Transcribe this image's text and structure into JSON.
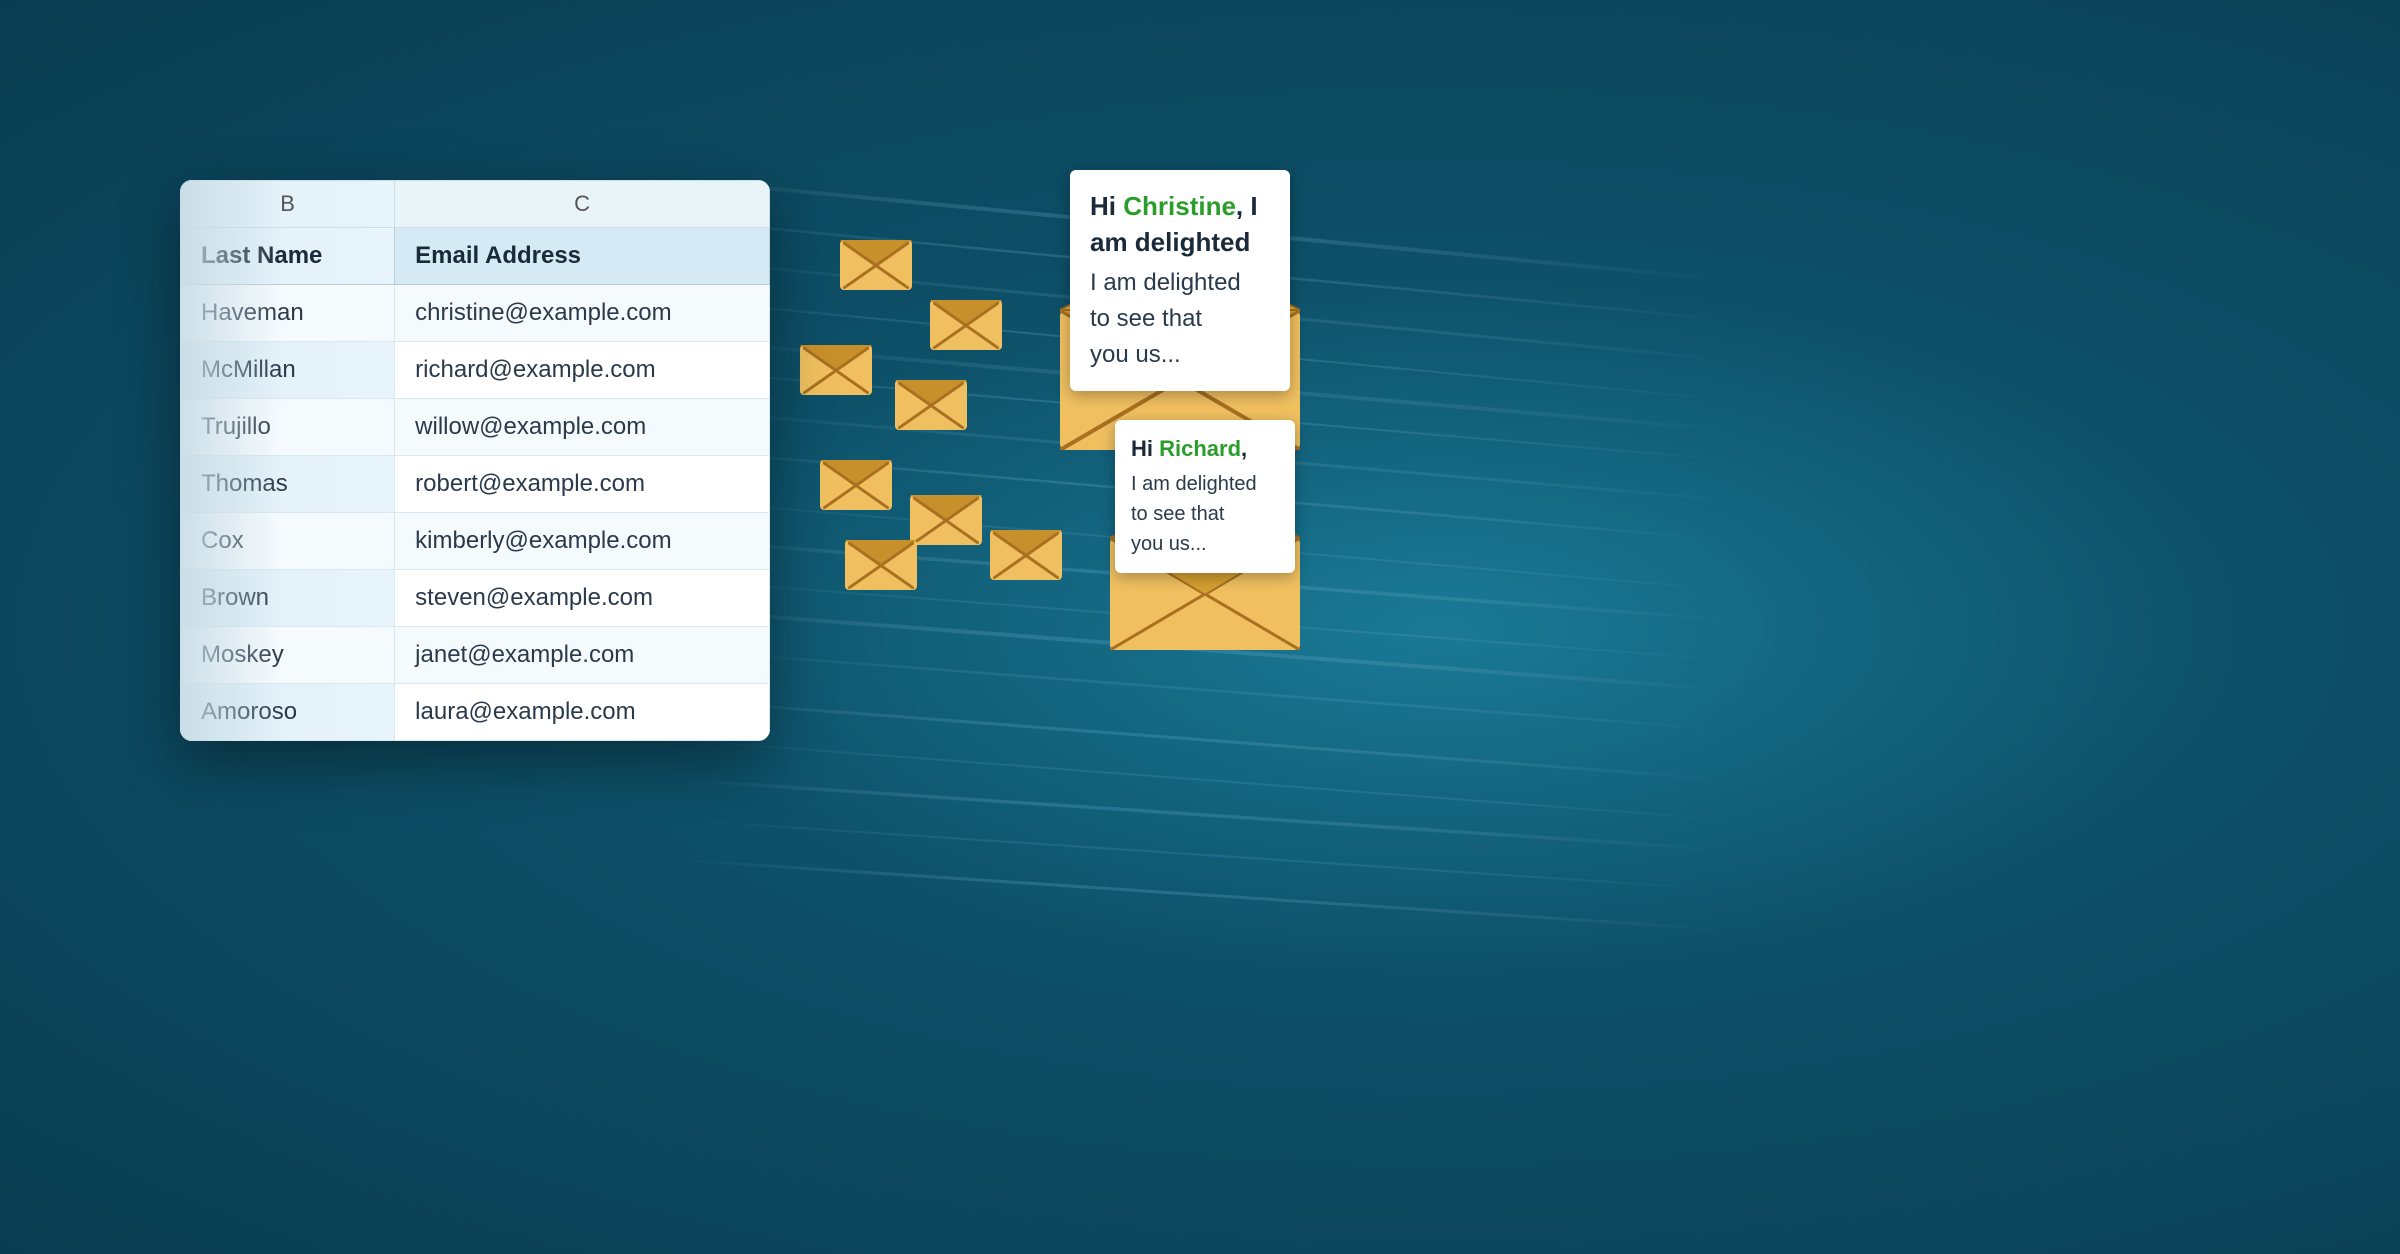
{
  "background": {
    "color": "#0d5068"
  },
  "spreadsheet": {
    "col_b_label": "B",
    "col_c_label": "C",
    "header_last_name": "Last Name",
    "header_email": "Email Address",
    "rows": [
      {
        "last_name": "Haveman",
        "email": "christine@example.com"
      },
      {
        "last_name": "McMillan",
        "email": "richard@example.com"
      },
      {
        "last_name": "Trujillo",
        "email": "willow@example.com"
      },
      {
        "last_name": "Thomas",
        "email": "robert@example.com"
      },
      {
        "last_name": "Cox",
        "email": "kimberly@example.com"
      },
      {
        "last_name": "Brown",
        "email": "steven@example.com"
      },
      {
        "last_name": "Moskey",
        "email": "janet@example.com"
      },
      {
        "last_name": "Amoroso",
        "email": "laura@example.com"
      }
    ]
  },
  "email1": {
    "greeting": "Hi ",
    "name": "Christine",
    "line1": ", I am delighted",
    "line2": "to see that",
    "line3": "you us..."
  },
  "email2": {
    "greeting": "Hi ",
    "name": "Richard",
    "line1": ", I am delighted",
    "line2": "to see that",
    "line3": "you us..."
  }
}
